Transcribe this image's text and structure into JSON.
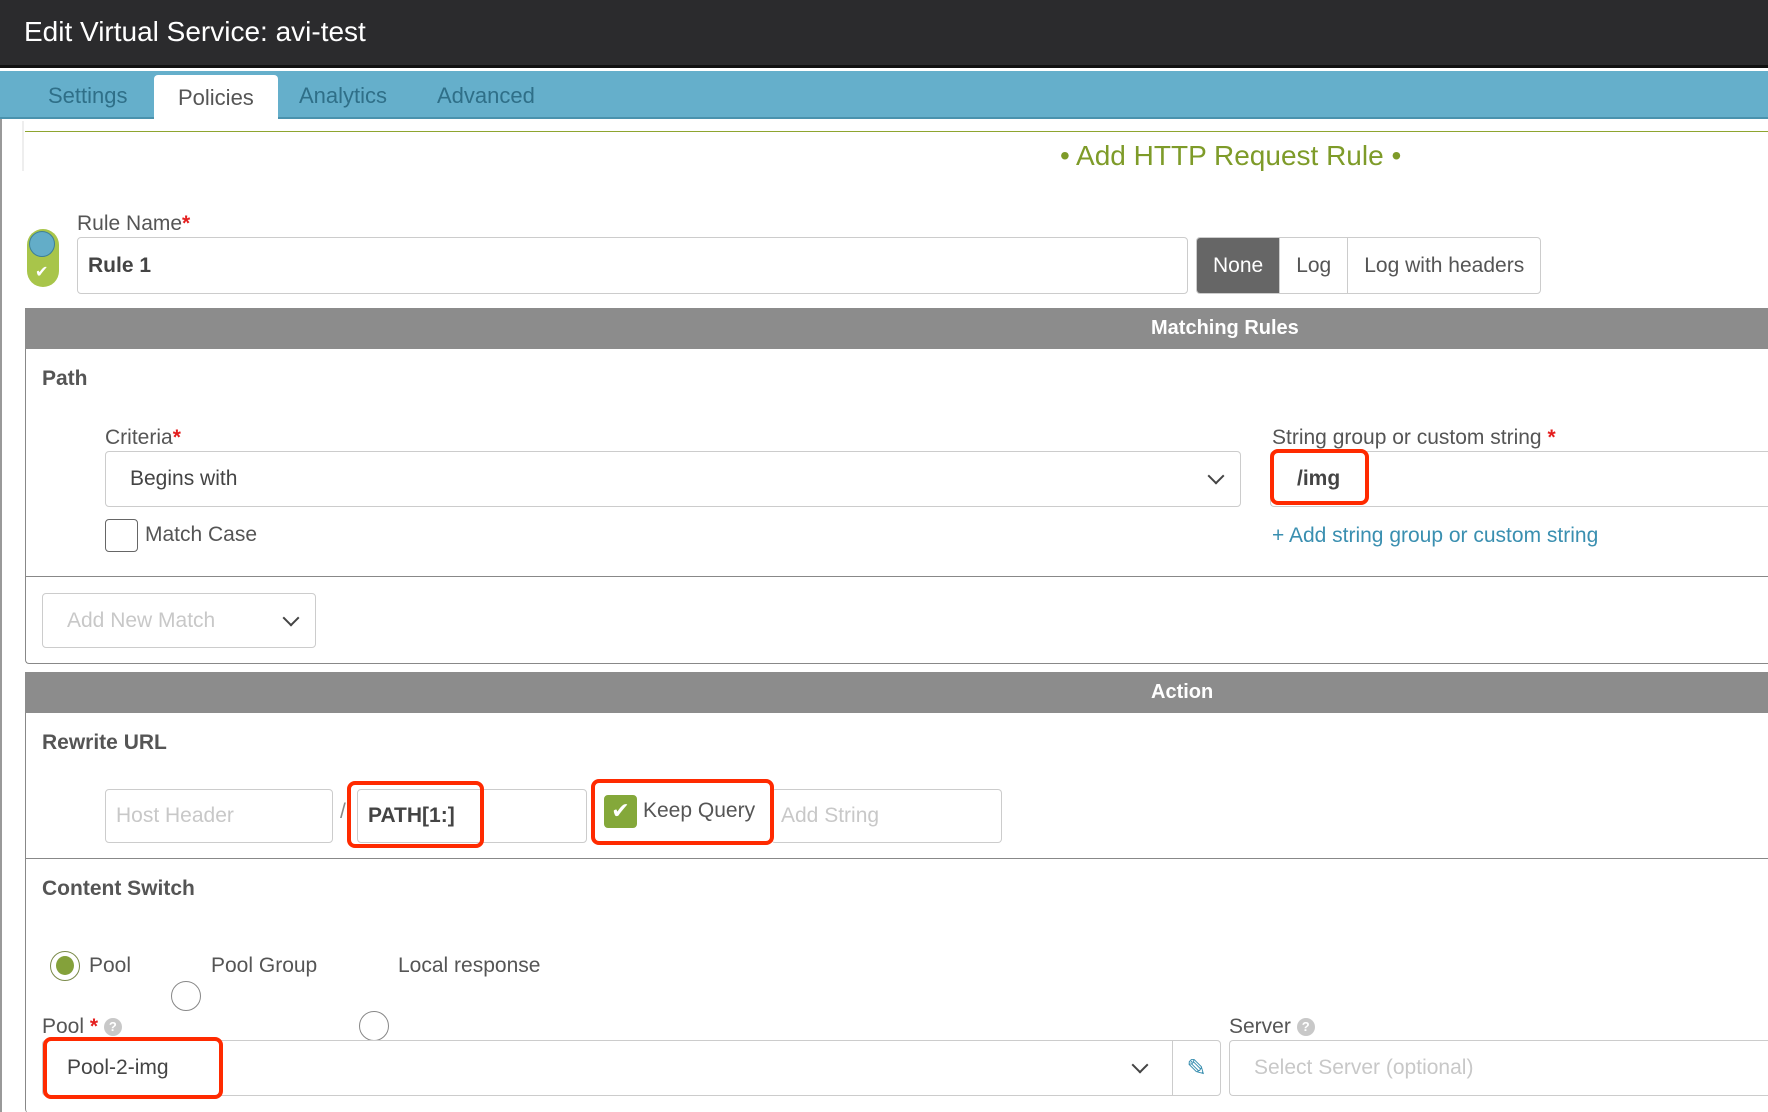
{
  "window": {
    "title": "Edit Virtual Service: avi-test"
  },
  "tabs": [
    {
      "label": "Settings",
      "active": false
    },
    {
      "label": "Policies",
      "active": true
    },
    {
      "label": "Analytics",
      "active": false
    },
    {
      "label": "Advanced",
      "active": false
    }
  ],
  "form": {
    "title": "• Add HTTP Request Rule •",
    "rule_enabled": true,
    "rule_name_label": "Rule Name",
    "required_mark": "*",
    "rule_name_value": "Rule 1",
    "logging": {
      "options": [
        "None",
        "Log",
        "Log with headers"
      ],
      "selected": "None"
    }
  },
  "matching": {
    "section_title": "Matching Rules",
    "path": {
      "heading": "Path",
      "criteria_label": "Criteria",
      "criteria_value": "Begins with",
      "match_case_label": "Match Case",
      "match_case_checked": false,
      "string_label": "String group or custom string",
      "string_value": "/img",
      "add_string_link": "+ Add string group or custom string"
    },
    "add_new_match_placeholder": "Add New Match"
  },
  "action": {
    "section_title": "Action",
    "rewrite_url": {
      "heading": "Rewrite URL",
      "host_header_placeholder": "Host Header",
      "separator": "/",
      "path_value": "PATH[1:]",
      "keep_query_label": "Keep Query",
      "keep_query_checked": true,
      "add_string_placeholder": "Add String"
    },
    "content_switch": {
      "heading": "Content Switch",
      "options": [
        "Pool",
        "Pool Group",
        "Local response"
      ],
      "selected": "Pool",
      "pool_label": "Pool",
      "pool_value": "Pool-2-img",
      "server_label": "Server",
      "server_placeholder": "Select Server (optional)",
      "help_glyph": "?"
    }
  },
  "icons": {
    "toggle_check": "✔",
    "checkmark": "✔",
    "pencil": "✎"
  },
  "colors": {
    "titlebar": "#2b2b2d",
    "tabbar": "#65afcb",
    "accent_green": "#7e9b29",
    "section_gray": "#8c8c8c",
    "link_blue": "#3a8fb0",
    "required_red": "#e41e1e",
    "highlight_red": "#ff2a00"
  }
}
